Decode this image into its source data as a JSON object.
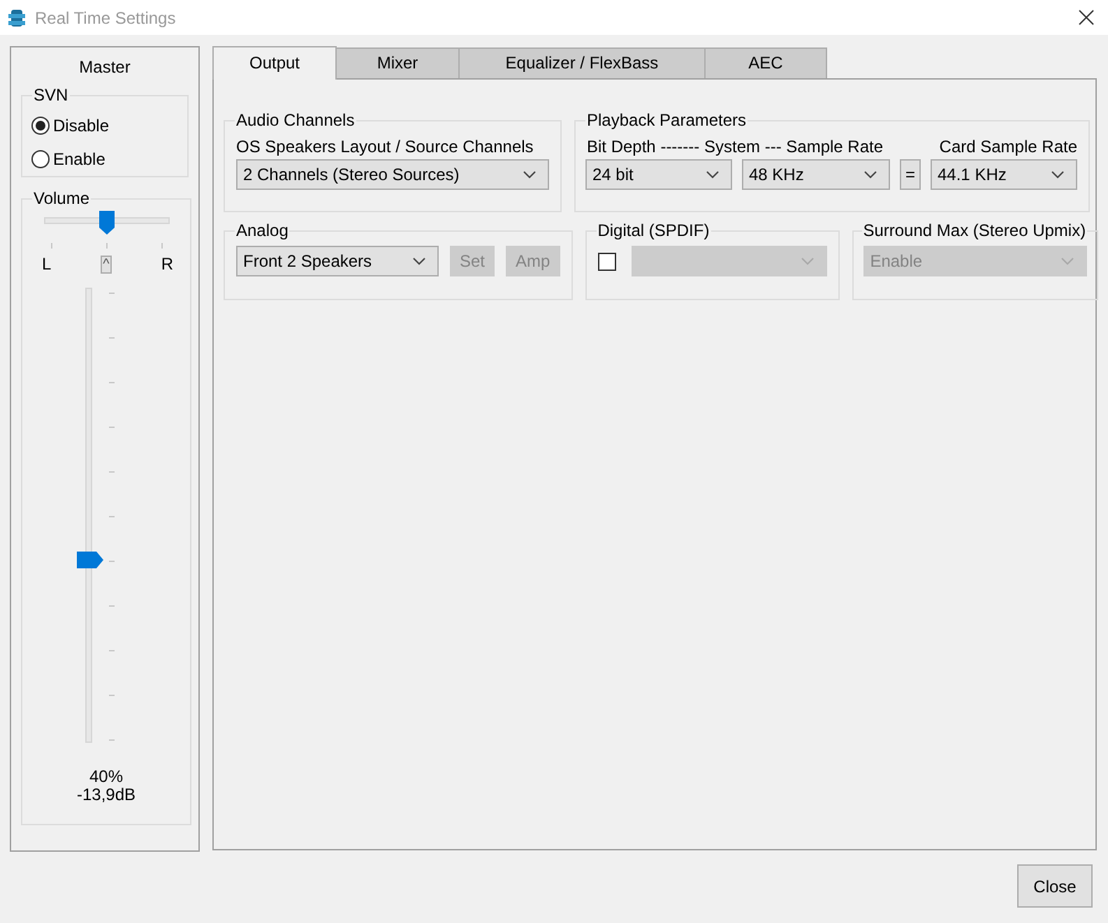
{
  "window": {
    "title": "Real Time Settings"
  },
  "master": {
    "title": "Master",
    "svn": {
      "label": "SVN",
      "options": [
        {
          "label": "Disable",
          "selected": true
        },
        {
          "label": "Enable",
          "selected": false
        }
      ]
    },
    "volume": {
      "label": "Volume",
      "balance": {
        "level": 0.5,
        "left": "L",
        "center": "^",
        "right": "R"
      },
      "level": 0.4,
      "percent": "40%",
      "db": "-13,9dB"
    }
  },
  "tabs": [
    {
      "label": "Output",
      "selected": true
    },
    {
      "label": "Mixer",
      "selected": false
    },
    {
      "label": "Equalizer / FlexBass",
      "selected": false
    },
    {
      "label": "AEC",
      "selected": false
    }
  ],
  "output": {
    "audio_channels": {
      "title": "Audio Channels",
      "label": "OS Speakers Layout / Source Channels",
      "value": "2 Channels (Stereo Sources)"
    },
    "playback": {
      "title": "Playback Parameters",
      "label": "Bit Depth ------- System --- Sample Rate",
      "bit_depth": "24 bit",
      "system_rate": "48 KHz",
      "equals": "=",
      "card_label": "Card Sample Rate",
      "card_rate": "44.1 KHz"
    },
    "analog": {
      "title": "Analog",
      "value": "Front 2 Speakers",
      "buttons": [
        {
          "label": "Set",
          "disabled": true
        },
        {
          "label": "Amp",
          "disabled": true
        }
      ]
    },
    "digital": {
      "title": "Digital (SPDIF)",
      "checked": false,
      "disabled": true
    },
    "surround": {
      "title": "Surround Max (Stereo Upmix)",
      "value": "Enable",
      "disabled": true
    }
  },
  "buttons": [
    {
      "label": "Close"
    }
  ]
}
